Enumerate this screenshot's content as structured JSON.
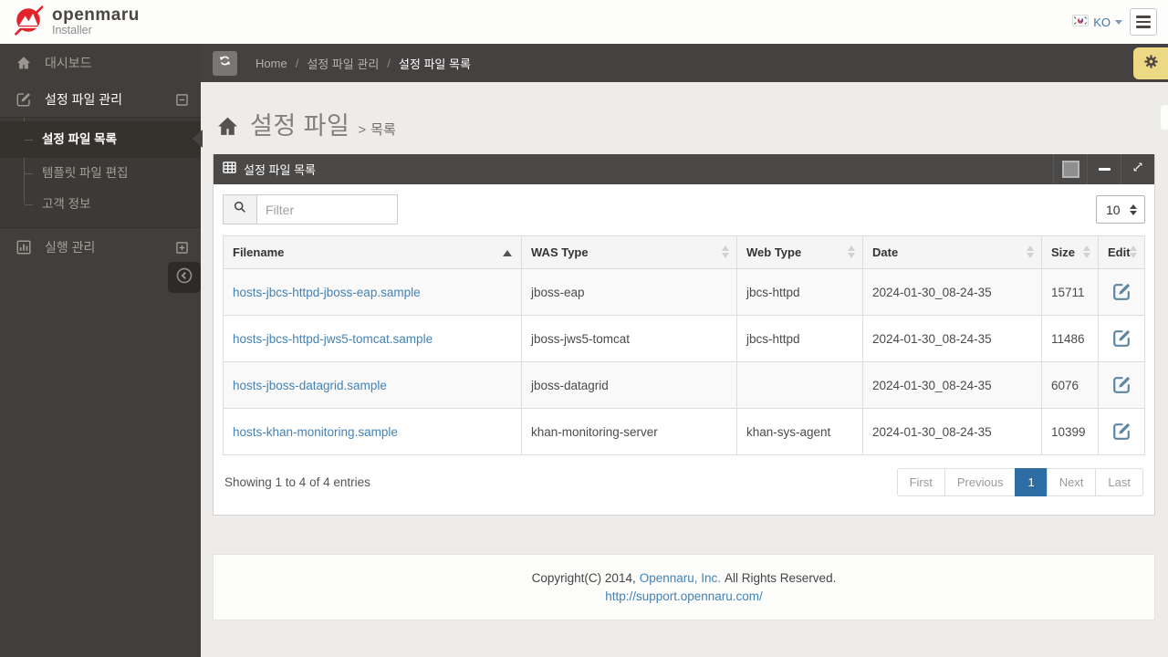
{
  "header": {
    "logo_title": "openmaru",
    "logo_subtitle": "Installer",
    "language_code": "KO"
  },
  "sidebar": {
    "dashboard": "대시보드",
    "config_management": "설정 파일 관리",
    "config_list": "설정 파일 목록",
    "template_edit": "템플릿 파일 편집",
    "customer_info": "고객 정보",
    "execution_management": "실행 관리"
  },
  "breadcrumb": {
    "home": "Home",
    "separator": "/",
    "section": "설정 파일 관리",
    "current": "설정 파일 목록"
  },
  "page": {
    "title": "설정 파일",
    "separator": ">",
    "subtitle": "목록"
  },
  "panel": {
    "title": "설정 파일 목록",
    "filter_placeholder": "Filter",
    "page_size": "10"
  },
  "table": {
    "columns": {
      "filename": "Filename",
      "was_type": "WAS Type",
      "web_type": "Web Type",
      "date": "Date",
      "size": "Size",
      "edit": "Edit"
    },
    "sort": {
      "column": "Filename",
      "direction": "asc"
    },
    "rows": [
      {
        "filename": "hosts-jbcs-httpd-jboss-eap.sample",
        "was_type": "jboss-eap",
        "web_type": "jbcs-httpd",
        "date": "2024-01-30_08-24-35",
        "size": "15711"
      },
      {
        "filename": "hosts-jbcs-httpd-jws5-tomcat.sample",
        "was_type": "jboss-jws5-tomcat",
        "web_type": "jbcs-httpd",
        "date": "2024-01-30_08-24-35",
        "size": "11486"
      },
      {
        "filename": "hosts-jboss-datagrid.sample",
        "was_type": "jboss-datagrid",
        "web_type": "",
        "date": "2024-01-30_08-24-35",
        "size": "6076"
      },
      {
        "filename": "hosts-khan-monitoring.sample",
        "was_type": "khan-monitoring-server",
        "web_type": "khan-sys-agent",
        "date": "2024-01-30_08-24-35",
        "size": "10399"
      }
    ],
    "summary": "Showing 1 to 4 of 4 entries"
  },
  "pagination": {
    "first": "First",
    "previous": "Previous",
    "page": "1",
    "next": "Next",
    "last": "Last"
  },
  "footer": {
    "copyright_prefix": "Copyright(C) 2014,",
    "company": "Opennaru, Inc.",
    "copyright_suffix": "All Rights Reserved.",
    "support_url": "http://support.opennaru.com/"
  },
  "colors": {
    "logo_red": "#e2242a",
    "link_blue": "#4382b5",
    "pagination_active": "#2e6da4",
    "edit_icon": "#5d87a1",
    "gear_tab": "#edd883",
    "sidebar_bg": "#413e3b"
  }
}
